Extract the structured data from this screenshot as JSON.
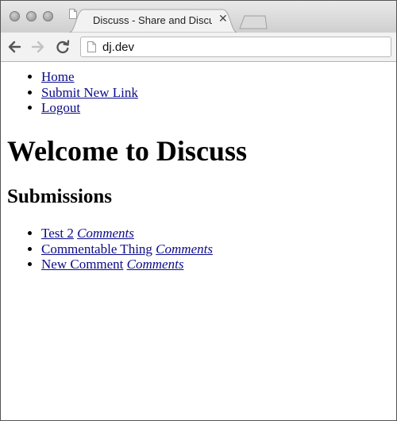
{
  "browser": {
    "tab_title": "Discuss - Share and Discuss",
    "close_glyph": "✕",
    "url": "dj.dev"
  },
  "nav": {
    "items": [
      {
        "label": "Home"
      },
      {
        "label": "Submit New Link"
      },
      {
        "label": "Logout"
      }
    ]
  },
  "page": {
    "heading": "Welcome to Discuss",
    "subheading": "Submissions"
  },
  "submissions": [
    {
      "title": "Test 2",
      "comments_label": "Comments"
    },
    {
      "title": "Commentable Thing",
      "comments_label": "Comments"
    },
    {
      "title": "New Comment",
      "comments_label": "Comments"
    }
  ],
  "colors": {
    "link": "#0b0b8a",
    "chrome": "#d6d6d6"
  }
}
